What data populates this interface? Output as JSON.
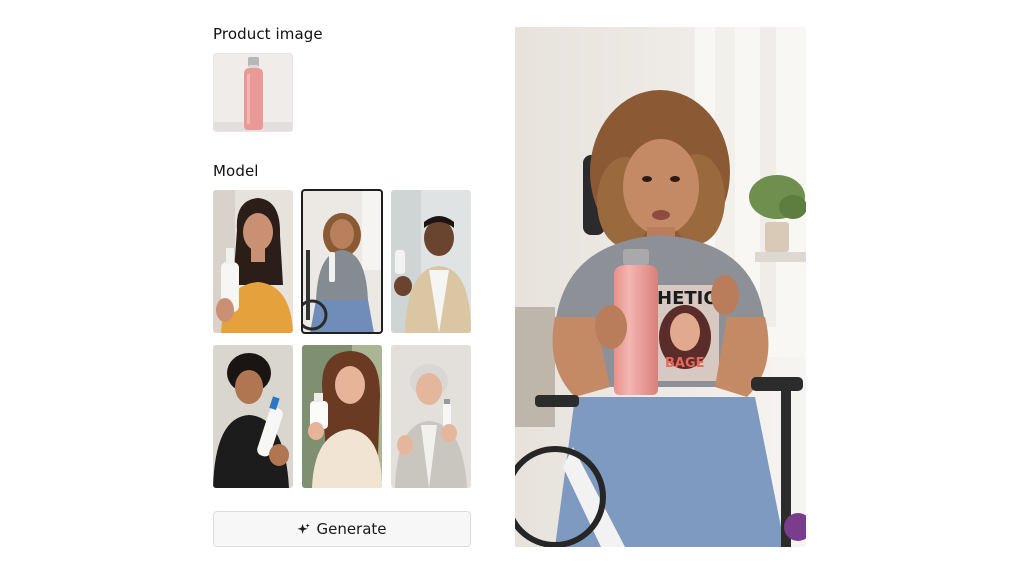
{
  "product_section": {
    "title": "Product image",
    "thumbnail_icon": "pink-bottle-image"
  },
  "model_section": {
    "title": "Model",
    "models": [
      {
        "id": "model-1",
        "icon": "woman-orange-sweater-image",
        "selected": false
      },
      {
        "id": "model-2",
        "icon": "woman-wheelchair-image",
        "selected": true
      },
      {
        "id": "model-3",
        "icon": "man-beige-jacket-image",
        "selected": false
      },
      {
        "id": "model-4",
        "icon": "teen-black-shirt-image",
        "selected": false
      },
      {
        "id": "model-5",
        "icon": "woman-cream-top-image",
        "selected": false
      },
      {
        "id": "model-6",
        "icon": "elderly-woman-cardigan-image",
        "selected": false
      }
    ]
  },
  "actions": {
    "generate_label": "Generate",
    "generate_icon": "sparkle-icon"
  },
  "preview": {
    "icon": "generated-preview-image",
    "shirt_text": "HETIOS",
    "shirt_text_2": "BAGE"
  },
  "colors": {
    "bottle_pink": "#e99a96",
    "selected_outline": "#1f1f1f",
    "button_bg": "#f7f7f7"
  }
}
